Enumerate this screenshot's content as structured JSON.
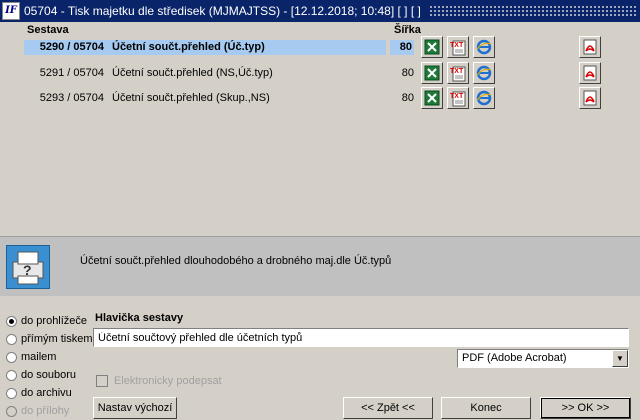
{
  "window": {
    "title": "05704 - Tisk  majetku dle středisek (MJMAJTSS) - [12.12.2018; 10:48]  [ ]  [ ]",
    "app_icon_text": "IF"
  },
  "list": {
    "col_sestava": "Sestava",
    "col_sirka": "Šířka",
    "rows": [
      {
        "code": "5290 / 05704",
        "name": "Účetní součt.přehled (Úč.typ)",
        "width": "80",
        "selected": true
      },
      {
        "code": "5291 / 05704",
        "name": "Účetní součt.přehled (NS,Úč.typ)",
        "width": "80",
        "selected": false
      },
      {
        "code": "5293 / 05704",
        "name": "Účetní součt.přehled (Skup.,NS)",
        "width": "80",
        "selected": false
      }
    ]
  },
  "description": {
    "text": "Účetní součt.přehled dlouhodobého a drobného maj.dle Úč.typů"
  },
  "output": {
    "options": [
      {
        "label": "do prohlížeče",
        "checked": true,
        "disabled": false
      },
      {
        "label": "přímým tiskem",
        "checked": false,
        "disabled": false
      },
      {
        "label": "mailem",
        "checked": false,
        "disabled": false
      },
      {
        "label": "do souboru",
        "checked": false,
        "disabled": false
      },
      {
        "label": "do archivu",
        "checked": false,
        "disabled": false
      },
      {
        "label": "do přílohy",
        "checked": false,
        "disabled": true
      }
    ]
  },
  "header_section": {
    "label": "Hlavička sestavy",
    "value": "Účetní součtový přehled dle účetních typů",
    "format_select": "PDF (Adobe Acrobat)",
    "esign_label": "Elektronicky podepsat"
  },
  "buttons": {
    "defaults": "Nastav výchozí",
    "back": "<< Zpět <<",
    "end": "Konec",
    "ok": ">> OK >>"
  },
  "icons": [
    "excel-icon",
    "txt-icon",
    "ie-icon",
    "pdf-icon",
    "printer-icon"
  ]
}
